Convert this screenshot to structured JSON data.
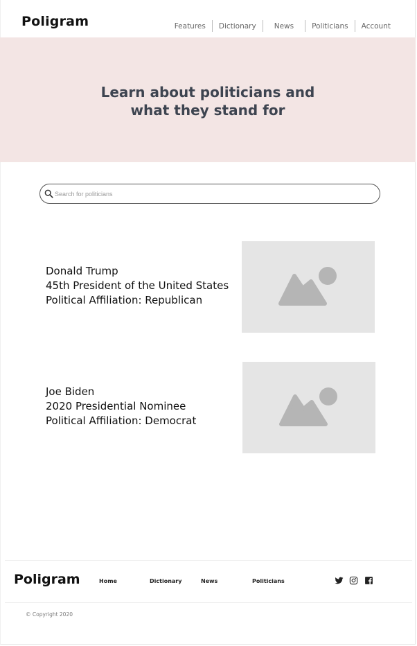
{
  "header": {
    "logo": "Poligram",
    "nav": [
      {
        "label": "Features"
      },
      {
        "label": "Dictionary"
      },
      {
        "label": "News"
      },
      {
        "label": "Politicians"
      },
      {
        "label": "Account"
      }
    ]
  },
  "hero": {
    "title": "Learn about politicians and\nwhat they stand for"
  },
  "search": {
    "placeholder": "Search for politicians",
    "value": ""
  },
  "politicians": [
    {
      "name": "Donald Trump",
      "role": "45th President of the United States",
      "affiliation": "Political Affiliation: Republican",
      "image_icon": "image-placeholder-icon"
    },
    {
      "name": "Joe Biden",
      "role": "2020 Presidential Nominee",
      "affiliation": "Political Affiliation: Democrat",
      "image_icon": "image-placeholder-icon"
    }
  ],
  "footer": {
    "logo": "Poligram",
    "links": [
      {
        "label": "Home"
      },
      {
        "label": "Dictionary"
      },
      {
        "label": "News"
      },
      {
        "label": "Politicians"
      }
    ],
    "social": [
      "twitter-icon",
      "instagram-icon",
      "facebook-icon"
    ],
    "copyright": "© Copyright 2020"
  },
  "colors": {
    "hero_bg": "#f3e5e4",
    "hero_text": "#3d4450",
    "placeholder_bg": "#e5e5e5",
    "placeholder_icon": "#b5b5b5"
  }
}
